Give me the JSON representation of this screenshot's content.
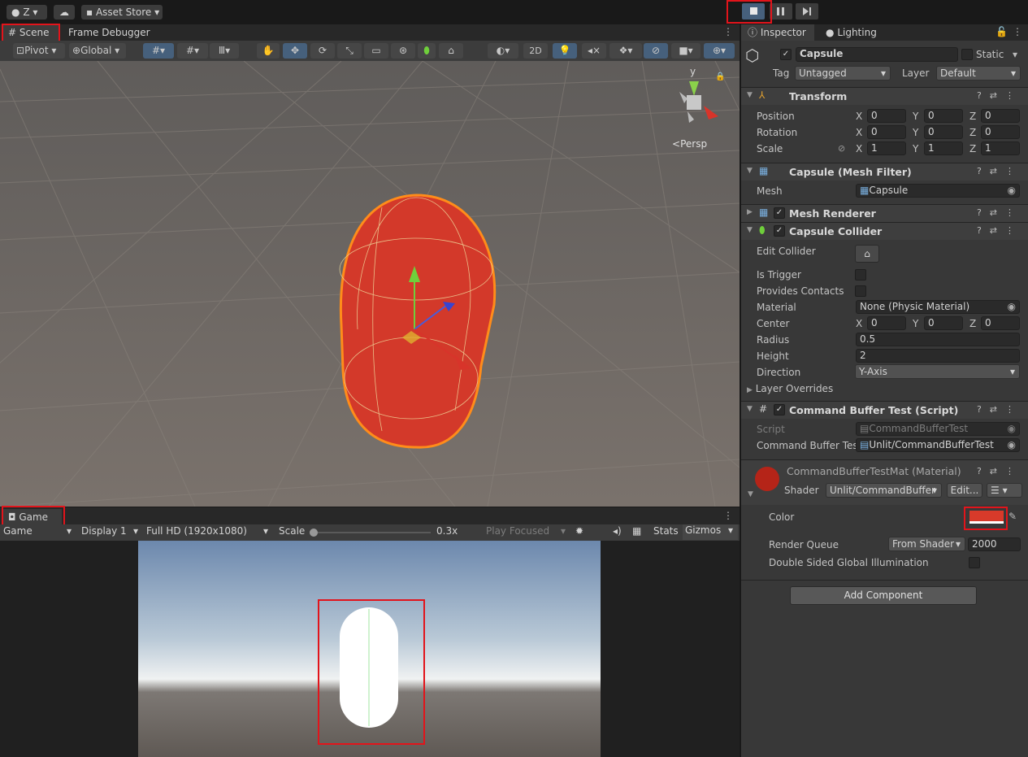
{
  "topbar": {
    "account": "Z",
    "asset_store": "Asset Store"
  },
  "scene_tabs": {
    "scene": "Scene",
    "frame_debugger": "Frame Debugger"
  },
  "scene_toolbar": {
    "pivot": "Pivot",
    "global": "Global",
    "mode_2d": "2D"
  },
  "scene_view": {
    "persp_label": "Persp",
    "gizmo_y": "y"
  },
  "game_tab": {
    "label": "Game",
    "display_mode": "Game",
    "display": "Display 1",
    "resolution": "Full HD (1920x1080)",
    "scale_label": "Scale",
    "scale_value": "0.3x",
    "play_focused": "Play Focused",
    "stats": "Stats",
    "gizmos": "Gizmos"
  },
  "inspector": {
    "tab_inspector": "Inspector",
    "tab_lighting": "Lighting",
    "object_name": "Capsule",
    "static_label": "Static",
    "tag_label": "Tag",
    "tag_value": "Untagged",
    "layer_label": "Layer",
    "layer_value": "Default",
    "transform": {
      "title": "Transform",
      "position_label": "Position",
      "rotation_label": "Rotation",
      "scale_label": "Scale",
      "position": [
        "0",
        "0",
        "0"
      ],
      "rotation": [
        "0",
        "0",
        "0"
      ],
      "scale": [
        "1",
        "1",
        "1"
      ]
    },
    "mesh_filter": {
      "title": "Capsule (Mesh Filter)",
      "mesh_label": "Mesh",
      "mesh_value": "Capsule"
    },
    "mesh_renderer": {
      "title": "Mesh Renderer"
    },
    "capsule_collider": {
      "title": "Capsule Collider",
      "edit_collider": "Edit Collider",
      "is_trigger": "Is Trigger",
      "provides_contacts": "Provides Contacts",
      "material_label": "Material",
      "material_value": "None (Physic Material)",
      "center_label": "Center",
      "center": [
        "0",
        "0",
        "0"
      ],
      "radius_label": "Radius",
      "radius": "0.5",
      "height_label": "Height",
      "height": "2",
      "direction_label": "Direction",
      "direction": "Y-Axis",
      "layer_overrides": "Layer Overrides"
    },
    "script_component": {
      "title": "Command Buffer Test (Script)",
      "script_label": "Script",
      "script_value": "CommandBufferTest",
      "cb_label": "Command Buffer Tes",
      "cb_value": "Unlit/CommandBufferTest"
    },
    "material": {
      "title": "CommandBufferTestMat (Material)",
      "shader_label": "Shader",
      "shader_value": "Unlit/CommandBuffer",
      "edit_label": "Edit...",
      "color_label": "Color",
      "color_value": "#d83a2a",
      "render_queue_label": "Render Queue",
      "render_queue_mode": "From Shader",
      "render_queue": "2000",
      "dsgi_label": "Double Sided Global Illumination"
    },
    "add_component": "Add Component"
  },
  "axes": {
    "x": "X",
    "y": "Y",
    "z": "Z"
  }
}
